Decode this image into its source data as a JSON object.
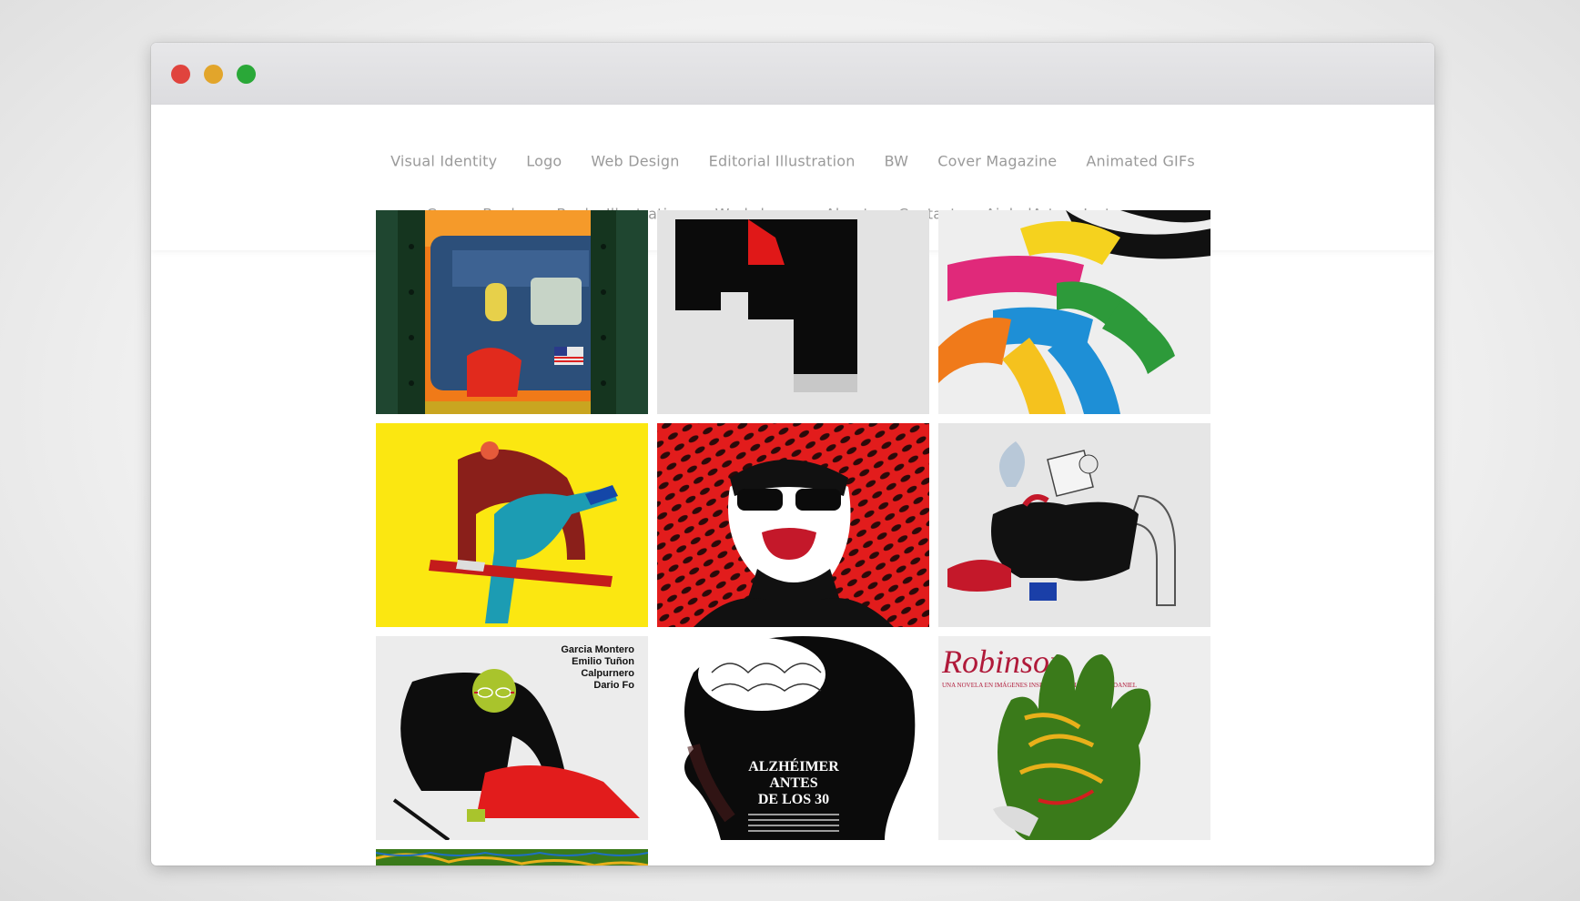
{
  "window": {
    "controls": [
      {
        "name": "close",
        "color": "#e0443e"
      },
      {
        "name": "minimize",
        "color": "#e2a52b"
      },
      {
        "name": "maximize",
        "color": "#2aa838"
      }
    ]
  },
  "nav": {
    "row1": [
      "Visual Identity",
      "Logo",
      "Web Design",
      "Editorial Illustration",
      "BW",
      "Cover Magazine",
      "Animated GIFs"
    ],
    "row2": [
      "Covers Books",
      "Books Illustration",
      "Workshops",
      "About",
      "Contact",
      "AjubelArt",
      "Instagram"
    ]
  },
  "gallery": {
    "tiles": [
      {
        "name": "subway-train-illustration"
      },
      {
        "name": "black-red-logo-mark"
      },
      {
        "name": "colorful-ribbons-illustration"
      },
      {
        "name": "figure-hurdling-illustration"
      },
      {
        "name": "sunglasses-portrait-red-pattern"
      },
      {
        "name": "reader-in-armchair-illustration"
      },
      {
        "name": "theatre-poster-figure",
        "text_lines": [
          "Garcia Montero",
          "Emilio Tuñon",
          "Calpurnero",
          "Dario Fo"
        ]
      },
      {
        "name": "alzheimer-brain-cover",
        "headline_lines": [
          "ALZHÉIMER",
          "ANTES",
          "DE LOS 30"
        ]
      },
      {
        "name": "robinson-book-cover-hand",
        "title": "Robinson",
        "subtitle": "UNA NOVELA EN IMÁGENES INSPIRADA EN LA OBRA DE DANIEL"
      },
      {
        "name": "jungle-illustration-partial"
      }
    ]
  }
}
